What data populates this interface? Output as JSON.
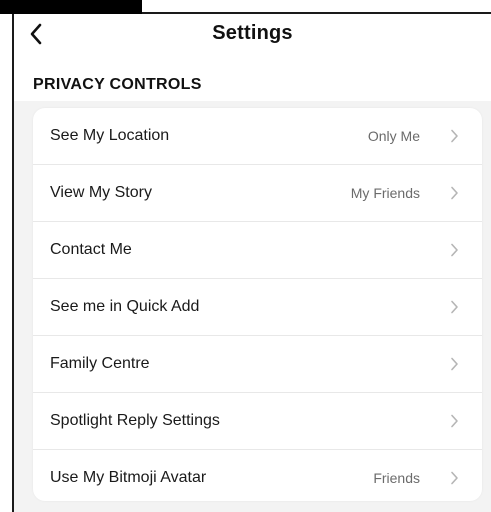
{
  "header": {
    "title": "Settings",
    "back_icon": "chevron-left-icon"
  },
  "section": {
    "title": "PRIVACY CONTROLS"
  },
  "rows": [
    {
      "label": "See My Location",
      "value": "Only Me"
    },
    {
      "label": "View My Story",
      "value": "My Friends"
    },
    {
      "label": "Contact Me",
      "value": ""
    },
    {
      "label": "See me in Quick Add",
      "value": ""
    },
    {
      "label": "Family Centre",
      "value": ""
    },
    {
      "label": "Spotlight Reply Settings",
      "value": ""
    },
    {
      "label": "Use My Bitmoji Avatar",
      "value": "Friends"
    }
  ],
  "colors": {
    "text_primary": "#1a1a1a",
    "text_secondary": "#6b6b6b",
    "chevron": "#b5b5b5",
    "background": "#f3f3f3",
    "card": "#ffffff"
  }
}
